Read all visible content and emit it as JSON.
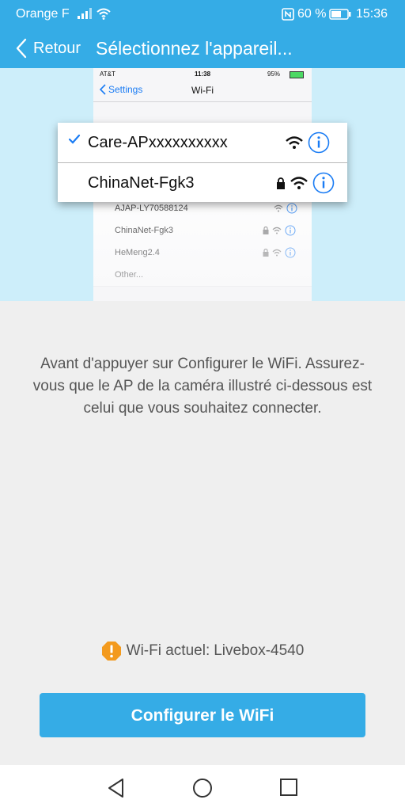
{
  "status_bar": {
    "carrier": "Orange F",
    "battery_percent": "60 %",
    "time": "15:36",
    "icons": [
      "signal-icon",
      "wifi-icon",
      "nfc-icon",
      "battery-icon"
    ]
  },
  "header": {
    "back_label": "Retour",
    "title": "Sélectionnez l'appareil..."
  },
  "illustration": {
    "phone_status": {
      "carrier": "AT&T",
      "time": "11:38",
      "battery": "95%"
    },
    "nav": {
      "back_label": "Settings",
      "title": "Wi-Fi"
    },
    "popup_networks": [
      {
        "name": "Care-APxxxxxxxxxx",
        "selected": true,
        "locked": false
      },
      {
        "name": "ChinaNet-Fgk3",
        "selected": false,
        "locked": true
      }
    ],
    "networks": [
      {
        "name": "AJAP-LY70588124",
        "locked": false
      },
      {
        "name": "ChinaNet-Fgk3",
        "locked": true
      },
      {
        "name": "HeMeng2.4",
        "locked": true
      },
      {
        "name": "Other...",
        "locked": null
      }
    ]
  },
  "instruction": "Avant d'appuyer sur Configurer le WiFi. Assurez-vous que le AP de la caméra illustré ci-dessous est celui que vous souhaitez connecter.",
  "current_wifi": {
    "label": "Wi-Fi actuel:",
    "value": "Livebox-4540",
    "icon": "warning-icon"
  },
  "config_button": "Configurer le WiFi",
  "colors": {
    "brand": "#35ace6",
    "illustration_bg": "#cdeefa",
    "page_bg": "#efefef",
    "warning": "#f39a1e",
    "ios_blue": "#1a7cf4"
  }
}
